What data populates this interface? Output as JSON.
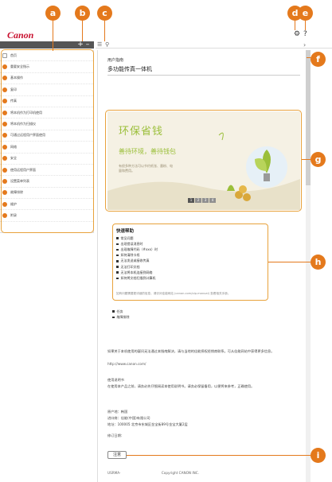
{
  "brand": {
    "logo": "Canon"
  },
  "callouts": [
    "a",
    "b",
    "c",
    "d",
    "e",
    "f",
    "g",
    "h",
    "i"
  ],
  "toolbar_left": {
    "expand_label": "+",
    "collapse_label": "–"
  },
  "toolbar_right": {
    "toc_icon": "list-icon",
    "search_icon": "search-icon"
  },
  "top_icons": {
    "settings": "⚙",
    "help": "?"
  },
  "nav": {
    "items": [
      "首页",
      "重要安全指示",
      "基本操作",
      "复印",
      "传真",
      "将本机作为打印机使用",
      "将本机作为扫描仪",
      "可通过远程用户界面使用",
      "网络",
      "安全",
      "使用远程用户界面",
      "设置菜单列表",
      "故障排除",
      "维护",
      "附录"
    ]
  },
  "doc": {
    "subtitle": "用户指南",
    "title": "多功能传真一体机"
  },
  "banner": {
    "title": "环保省钱",
    "subtitle": "善待环境，善待钱包",
    "text": "有很多种方法可以节约纸张、墨粉、电量和费用。",
    "pages": [
      "1",
      "2",
      "3",
      "4"
    ]
  },
  "quick": {
    "title": "快速帮助",
    "items": [
      "常见问题",
      "出现错误消息时",
      "出现故障代码（#xxx）时",
      "如何清除卡纸",
      "无法发送或接收传真",
      "无法打印文档",
      "无法将本机连接到网络",
      "如何将文档扫描到计算机"
    ],
    "note": "如有问题需要更详细的信息，请访问佳能网站 (canon.com/oip-manual) 查看相关手册。",
    "links": [
      "任务",
      "故障排除"
    ]
  },
  "body": {
    "para1": "如果关于本机使用的疑问无法通过本指南解决，请与当地的佳能授权经销商联系。可从佳能网站中获得更多信息。",
    "url": "http://www.canon.com/",
    "para2_title": "使用说明书",
    "para2": "在使用本产品之前，请务必先仔细阅读本使用说明书。请务必保留备用，以便将来参考，正确使用。",
    "maker": "原产地：韩国",
    "importer": "进口商：佳能(中国)有限公司",
    "address": "地址：100005 北京市东城区金宝街89号金宝大厦2层",
    "revised": "修订日期："
  },
  "notice_label": "注意",
  "footer": {
    "code": "USRMA-",
    "copyright": "Copyright CANON INC."
  }
}
